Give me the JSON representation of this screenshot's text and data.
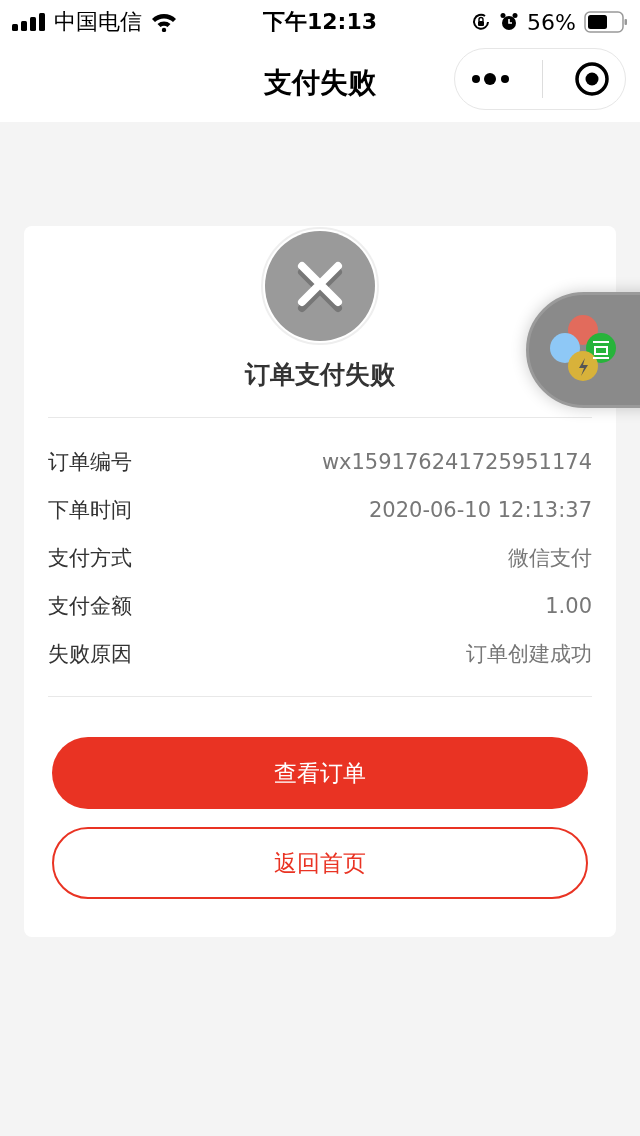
{
  "status_bar": {
    "carrier": "中国电信",
    "time": "下午12:13",
    "battery": "56%"
  },
  "nav": {
    "title": "支付失败"
  },
  "result": {
    "title": "订单支付失败"
  },
  "details": [
    {
      "label": "订单编号",
      "value": "wx159176241725951174"
    },
    {
      "label": "下单时间",
      "value": "2020-06-10 12:13:37"
    },
    {
      "label": "支付方式",
      "value": "微信支付"
    },
    {
      "label": "支付金额",
      "value": "1.00"
    },
    {
      "label": "失败原因",
      "value": "订单创建成功"
    }
  ],
  "buttons": [
    {
      "label": "查看订单",
      "kind": "primary"
    },
    {
      "label": "返回首页",
      "kind": "outline"
    }
  ]
}
